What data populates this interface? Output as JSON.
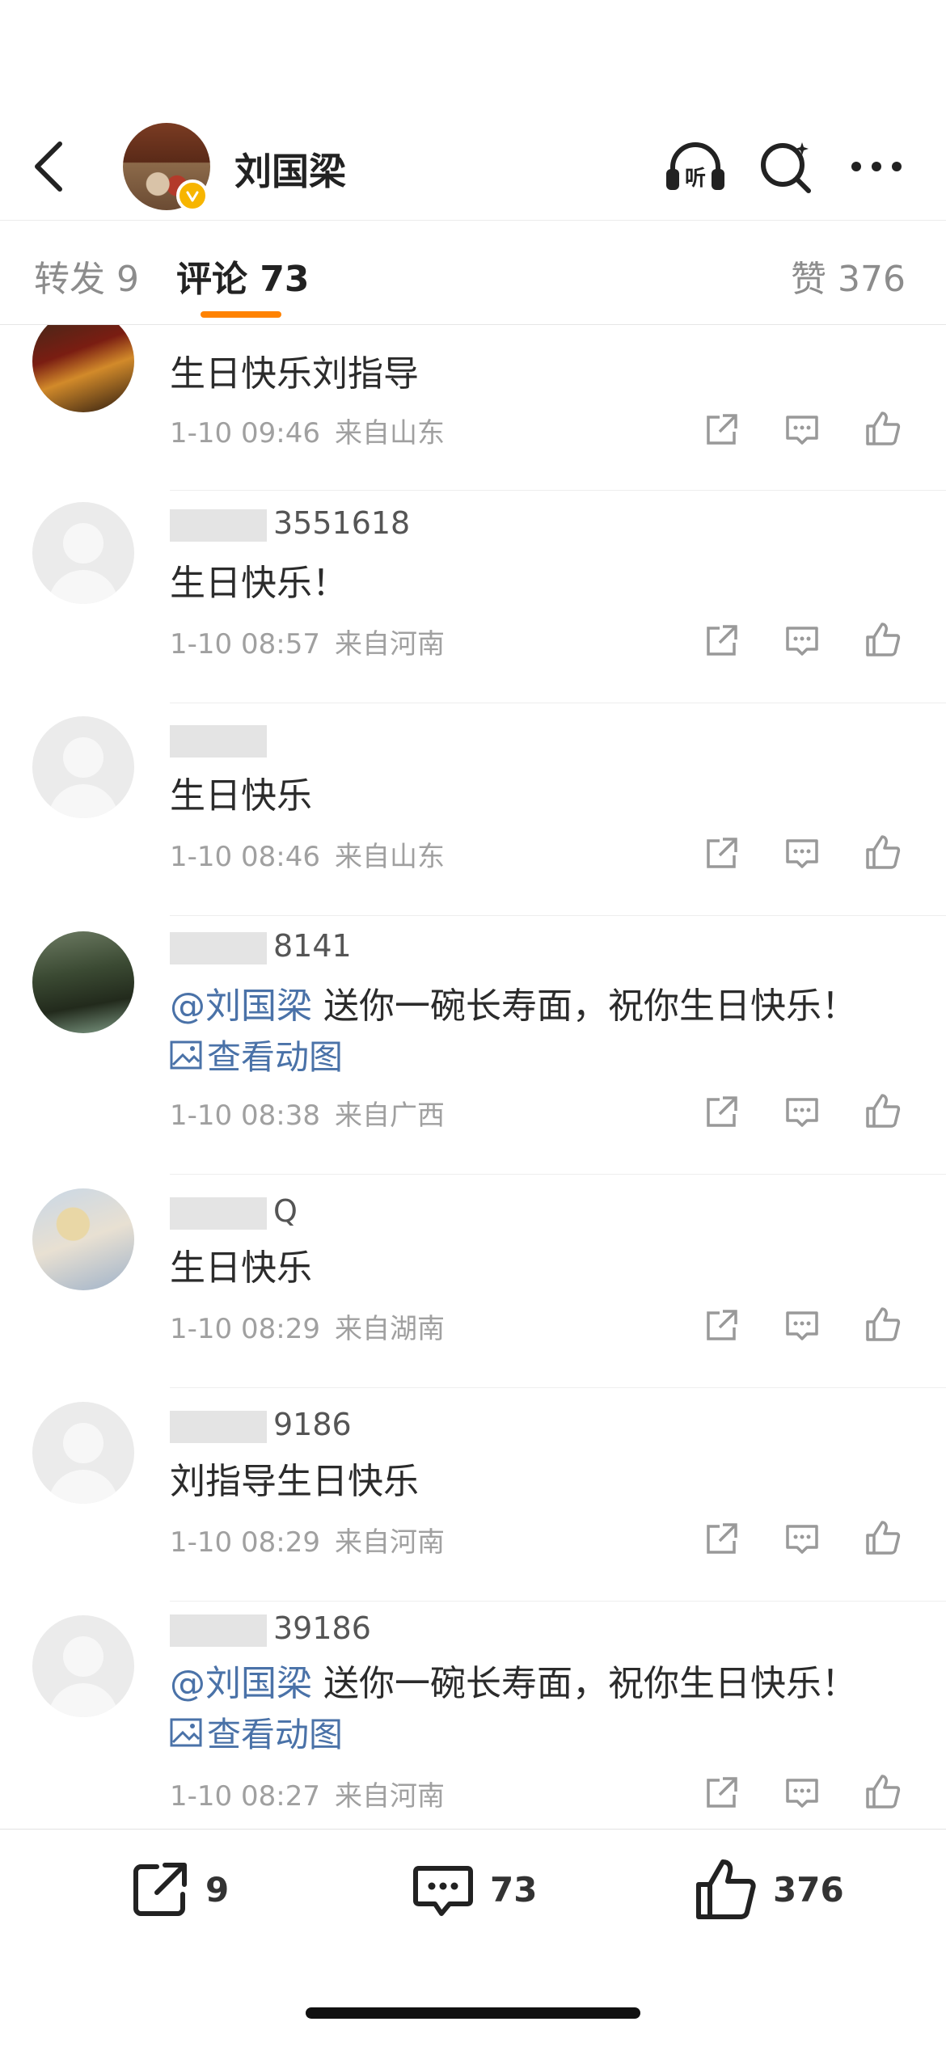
{
  "header": {
    "title": "刘国梁",
    "icons": [
      "back-icon",
      "listen-icon",
      "search-icon",
      "more-icon"
    ]
  },
  "tabs": {
    "repost_label": "转发 9",
    "comment_label": "评论 73",
    "like_label": "赞 376"
  },
  "comments": [
    {
      "user": "",
      "text": "生日快乐刘指导",
      "time": "1-10 09:46",
      "location": "来自山东"
    },
    {
      "user": "3551618",
      "text": "生日快乐！",
      "time": "1-10 08:57",
      "location": "来自河南"
    },
    {
      "user": "",
      "text": "生日快乐",
      "time": "1-10 08:46",
      "location": "来自山东"
    },
    {
      "user": "8141",
      "mention": "@刘国梁",
      "text": "送你一碗长寿面，祝你生日快乐！",
      "link": "查看动图",
      "time": "1-10 08:38",
      "location": "来自广西"
    },
    {
      "user": "Q",
      "text": "生日快乐",
      "time": "1-10 08:29",
      "location": "来自湖南"
    },
    {
      "user": "9186",
      "text": "刘指导生日快乐",
      "time": "1-10 08:29",
      "location": "来自河南"
    },
    {
      "user": "39186",
      "mention": "@刘国梁",
      "text": "送你一碗长寿面，祝你生日快乐！",
      "link": "查看动图",
      "time": "1-10 08:27",
      "location": "来自河南"
    }
  ],
  "bottom_bar": {
    "repost_count": "9",
    "comment_count": "73",
    "like_count": "376"
  },
  "colors": {
    "accent": "#ff8200",
    "link": "#4a72a8",
    "verified": "#f7b500"
  }
}
